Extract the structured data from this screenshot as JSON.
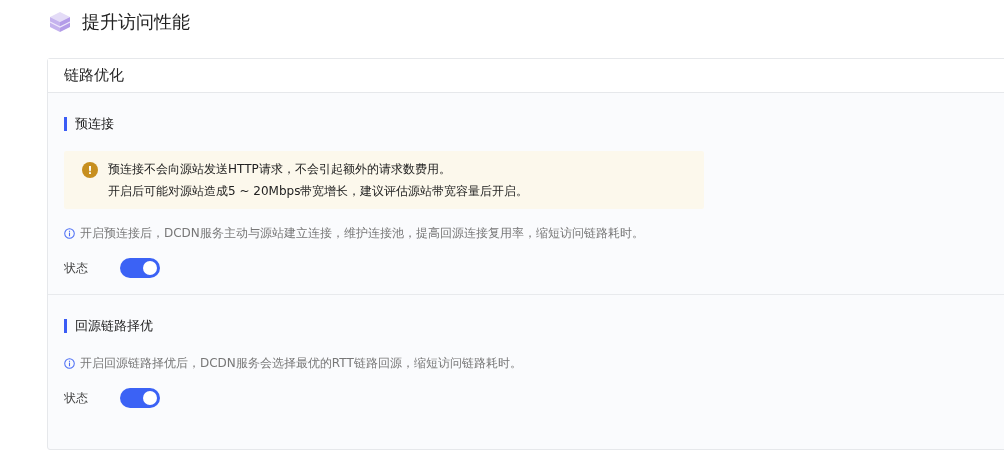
{
  "page": {
    "title": "提升访问性能"
  },
  "card": {
    "title": "链路优化",
    "sections": [
      {
        "title": "预连接",
        "alert": {
          "icon": "!",
          "lines": [
            "预连接不会向源站发送HTTP请求，不会引起额外的请求数费用。",
            "开启后可能对源站造成5 ~ 20Mbps带宽增长，建议评估源站带宽容量后开启。"
          ]
        },
        "hint": "开启预连接后，DCDN服务主动与源站建立连接，维护连接池，提高回源连接复用率，缩短访问链路耗时。",
        "status_label": "状态",
        "on": true
      },
      {
        "title": "回源链路择优",
        "hint": "开启回源链路择优后，DCDN服务会选择最优的RTT链路回源，缩短访问链路耗时。",
        "status_label": "状态",
        "on": true
      }
    ]
  }
}
